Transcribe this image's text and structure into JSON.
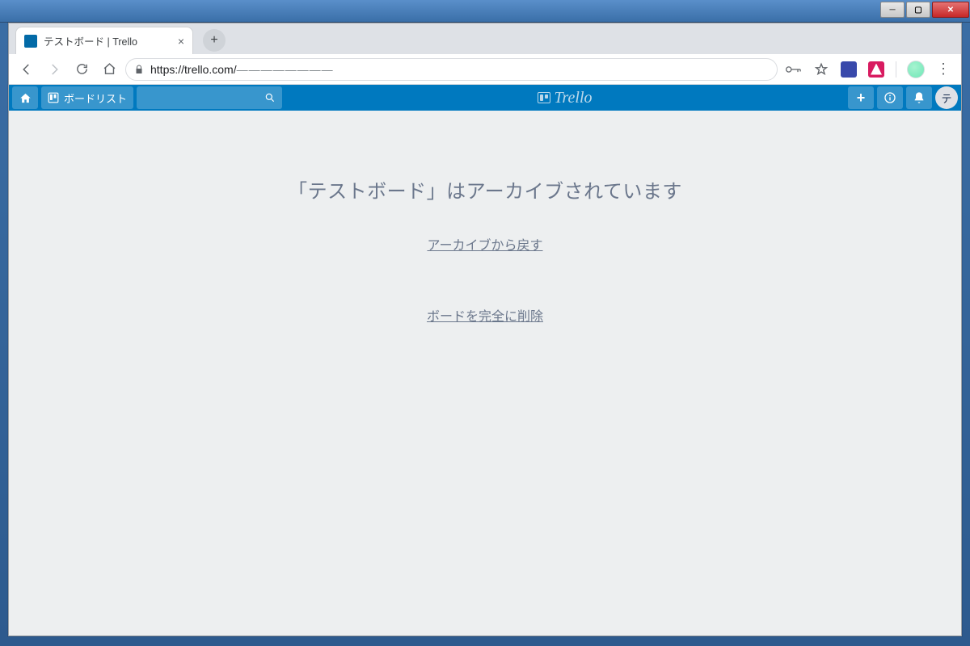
{
  "window": {
    "tab_title": "テストボード | Trello",
    "url_host": "https://trello.com/",
    "url_path_obscured": "————————"
  },
  "trello_nav": {
    "boards_label": "ボードリスト",
    "logo_text": "Trello",
    "avatar_initial": "テ"
  },
  "page": {
    "archived_heading": "「テストボード」はアーカイブされています",
    "restore_link": "アーカイブから戻す",
    "delete_link": "ボードを完全に削除"
  }
}
